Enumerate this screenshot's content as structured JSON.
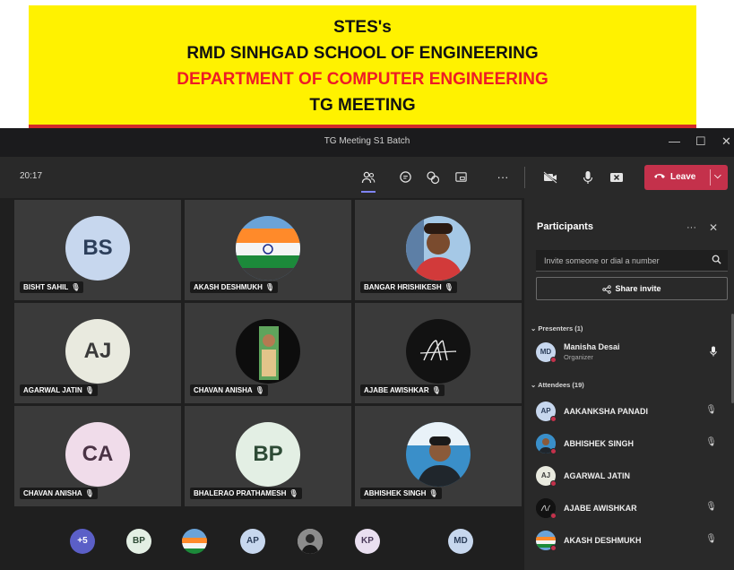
{
  "banner": {
    "line1": "STES's",
    "line2": "RMD SINHGAD SCHOOL OF ENGINEERING",
    "line3": "DEPARTMENT OF COMPUTER ENGINEERING",
    "line4": "TG MEETING"
  },
  "window": {
    "title": "TG Meeting S1 Batch",
    "minimize": "—",
    "maximize": "☐",
    "close": "✕"
  },
  "toolbar": {
    "time": "20:17",
    "more": "···",
    "leave_label": "Leave"
  },
  "colors": {
    "banner_bg": "#fff200",
    "banner_red_text": "#ee1c25",
    "leave_button": "#c4314b",
    "accent": "#7f85f5"
  },
  "tiles": [
    {
      "name": "BISHT SAHIL",
      "initials": "BS",
      "bg": "#c7d7ee",
      "fg": "#2c3e5a"
    },
    {
      "name": "AKASH DESHMUKH",
      "photo": true
    },
    {
      "name": "BANGAR HRISHIKESH",
      "photo": true
    },
    {
      "name": "AGARWAL JATIN",
      "initials": "AJ",
      "bg": "#e9eadf",
      "fg": "#3a3a3a"
    },
    {
      "name": "CHAVAN ANISHA",
      "photo": true
    },
    {
      "name": "AJABE AWISHKAR",
      "photo": true
    },
    {
      "name": "CHAVAN ANISHA",
      "initials": "CA",
      "bg": "#f0dcea",
      "fg": "#4a3345"
    },
    {
      "name": "BHALERAO PRATHAMESH",
      "initials": "BP",
      "bg": "#e3efe4",
      "fg": "#2d4a35"
    },
    {
      "name": "ABHISHEK SINGH",
      "photo": true
    }
  ],
  "strip": [
    {
      "text": "+5",
      "bg": "#5b5fc7",
      "fg": "#ffffff"
    },
    {
      "text": "BP",
      "bg": "#e3efe4",
      "fg": "#2d4a35"
    },
    {
      "text": "",
      "photo": true
    },
    {
      "text": "AP",
      "bg": "#c7d7ee",
      "fg": "#2c3e5a"
    },
    {
      "text": "",
      "photo": true
    },
    {
      "text": "KP",
      "bg": "#e9dff0",
      "fg": "#4a3a5a"
    },
    {
      "text": "MD",
      "bg": "#c7d7ee",
      "fg": "#2c3e5a"
    }
  ],
  "panel": {
    "title": "Participants",
    "more": "···",
    "invite_placeholder": "Invite someone or dial a number",
    "share_label": "Share invite",
    "presenters_label": "Presenters (1)",
    "attendees_label": "Attendees (19)",
    "presenter": {
      "name": "Manisha Desai",
      "role": "Organizer",
      "initials": "MD"
    },
    "attendees": [
      {
        "name": "AAKANKSHA PANADI",
        "initials": "AP"
      },
      {
        "name": "ABHISHEK SINGH",
        "initials": ""
      },
      {
        "name": "AGARWAL JATIN",
        "initials": "AJ"
      },
      {
        "name": "AJABE AWISHKAR",
        "initials": ""
      },
      {
        "name": "AKASH DESHMUKH",
        "initials": ""
      }
    ]
  }
}
